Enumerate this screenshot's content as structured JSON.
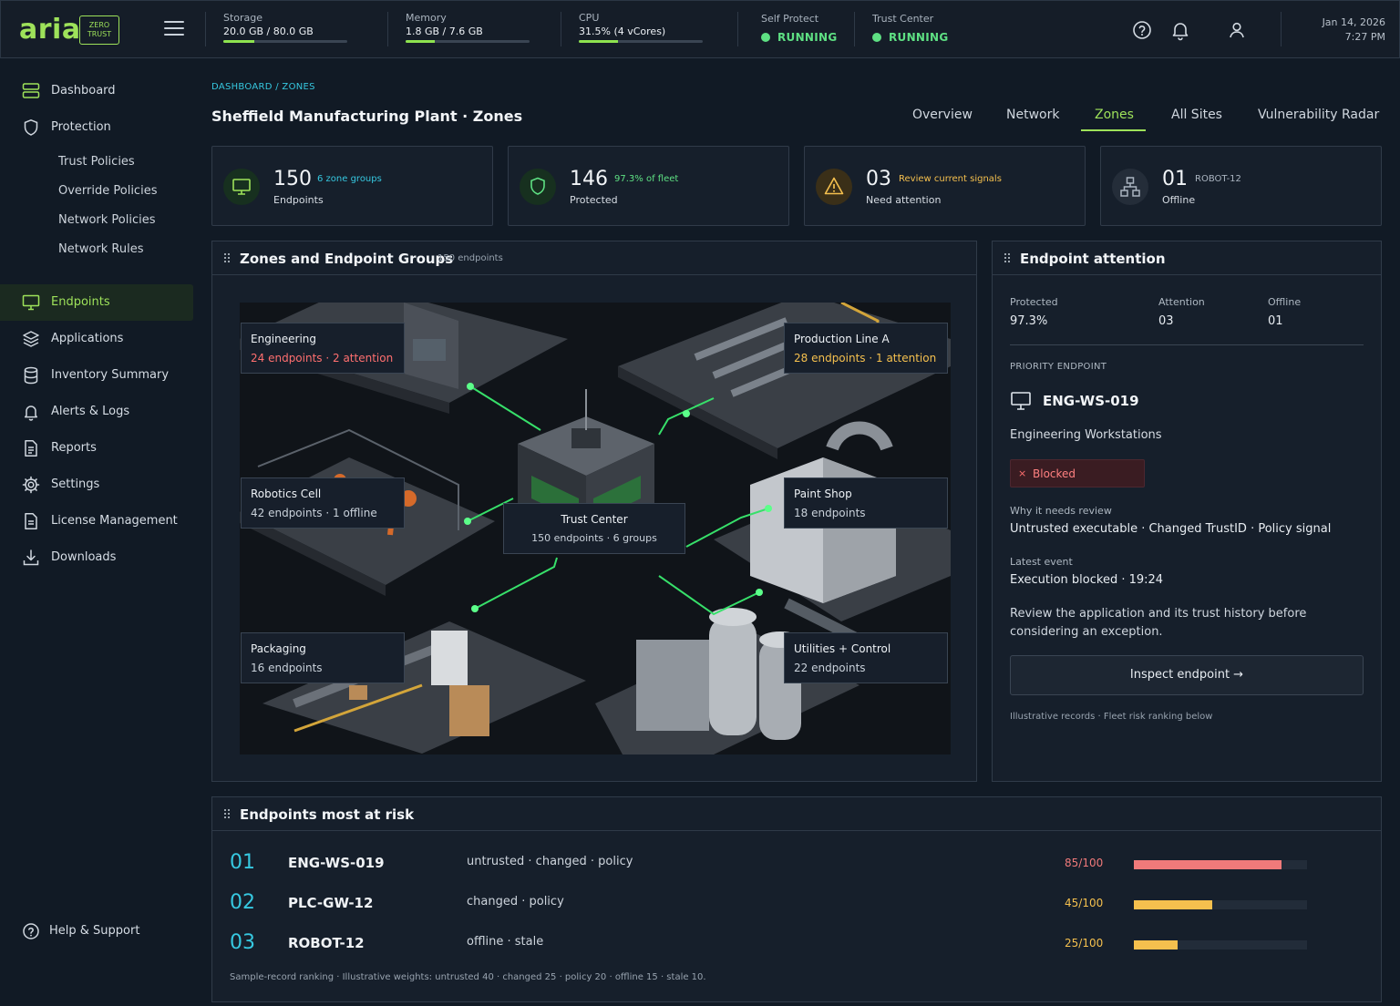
{
  "header": {
    "logo": "aria",
    "badge_line1": "ZERO",
    "badge_line2": "TRUST",
    "metrics": [
      {
        "label": "Storage",
        "value": "20.0 GB / 80.0 GB",
        "fraction": 0.25
      },
      {
        "label": "Memory",
        "value": "1.8 GB / 7.6 GB",
        "fraction": 0.237
      },
      {
        "label": "CPU",
        "value": "31.5% (4 vCores)",
        "fraction": 0.315
      }
    ],
    "self_protect": {
      "label": "Self Protect",
      "value": "RUNNING"
    },
    "trust_center": {
      "label": "Trust Center",
      "value": "RUNNING"
    },
    "date": "Jan 14, 2026",
    "time": "7:27 PM",
    "icons": [
      "help-icon",
      "bell-icon",
      "user-icon"
    ]
  },
  "sidebar": {
    "items": [
      {
        "label": "Dashboard",
        "icon": "dashboard-icon"
      },
      {
        "label": "Protection",
        "icon": "shield-icon"
      },
      {
        "label": "Endpoints",
        "icon": "monitor-icon",
        "active": true
      },
      {
        "label": "Applications",
        "icon": "layers-icon"
      },
      {
        "label": "Inventory Summary",
        "icon": "database-icon"
      },
      {
        "label": "Alerts & Logs",
        "icon": "bell-icon"
      },
      {
        "label": "Reports",
        "icon": "report-icon"
      },
      {
        "label": "Settings",
        "icon": "gear-icon"
      },
      {
        "label": "License Management",
        "icon": "license-icon"
      },
      {
        "label": "Downloads",
        "icon": "download-icon"
      }
    ],
    "sub_items": [
      "Trust Policies",
      "Override Policies",
      "Network Policies",
      "Network Rules"
    ],
    "help": "Help & Support"
  },
  "page": {
    "breadcrumb": "DASHBOARD / ZONES",
    "title": "Sheffield Manufacturing Plant · Zones",
    "tabs": [
      "Overview",
      "Network",
      "Zones",
      "All Sites",
      "Vulnerability Radar"
    ],
    "active_tab": "Zones"
  },
  "stats": [
    {
      "value": "150",
      "note": "6 zone groups",
      "label": "Endpoints",
      "color": "#36c8e0"
    },
    {
      "value": "146",
      "note": "97.3% of fleet",
      "label": "Protected",
      "color": "#5ee083"
    },
    {
      "value": "03",
      "note": "Review current signals",
      "label": "Need attention",
      "color": "#f5c04e"
    },
    {
      "value": "01",
      "note": "ROBOT-12",
      "label": "Offline",
      "color": "#aab4c0"
    }
  ],
  "zones_panel": {
    "title": "Zones and Endpoint Groups",
    "subtitle": "150 endpoints",
    "zones": [
      {
        "name": "Engineering",
        "detail": "24 endpoints · 2 attention",
        "color": "#ff6f6f"
      },
      {
        "name": "Production Line A",
        "detail": "28 endpoints · 1 attention",
        "color": "#f5c04e"
      },
      {
        "name": "Robotics Cell",
        "detail": "42 endpoints · 1 offline",
        "color": "#c9d1da"
      },
      {
        "name": "Trust Center",
        "detail": "150 endpoints · 6 groups",
        "color": "#c9d1da"
      },
      {
        "name": "Paint Shop",
        "detail": "18 endpoints",
        "color": "#c9d1da"
      },
      {
        "name": "Packaging",
        "detail": "16 endpoints",
        "color": "#c9d1da"
      },
      {
        "name": "Utilities + Control",
        "detail": "22 endpoints",
        "color": "#c9d1da"
      }
    ]
  },
  "attention_panel": {
    "title": "Endpoint attention",
    "summary": [
      {
        "label": "Protected",
        "value": "97.3%"
      },
      {
        "label": "Attention",
        "value": "03"
      },
      {
        "label": "Offline",
        "value": "01"
      }
    ],
    "priority_label": "PRIORITY ENDPOINT",
    "endpoint_id": "ENG-WS-019",
    "group": "Engineering Workstations",
    "status": "Blocked",
    "why_label": "Why it needs review",
    "why_value": "Untrusted executable · Changed TrustID · Policy signal",
    "event_label": "Latest event",
    "event_value": "Execution blocked · 19:24",
    "advice": "Review the application and its trust history before considering an exception.",
    "button": "Inspect endpoint →",
    "footnote": "Illustrative records · Fleet risk ranking below"
  },
  "risk_panel": {
    "title": "Endpoints most at risk",
    "rows": [
      {
        "rank": "01",
        "id": "ENG-WS-019",
        "tags": "untrusted · changed · policy",
        "score": "85/100",
        "fraction": 0.85,
        "color": "#f07a7a"
      },
      {
        "rank": "02",
        "id": "PLC-GW-12",
        "tags": "changed · policy",
        "score": "45/100",
        "fraction": 0.45,
        "color": "#f5c04e"
      },
      {
        "rank": "03",
        "id": "ROBOT-12",
        "tags": "offline · stale",
        "score": "25/100",
        "fraction": 0.25,
        "color": "#f5c04e"
      }
    ],
    "footnote": "Sample-record ranking · Illustrative weights: untrusted 40 · changed 25 · policy 20 · offline 15 · stale 10."
  }
}
